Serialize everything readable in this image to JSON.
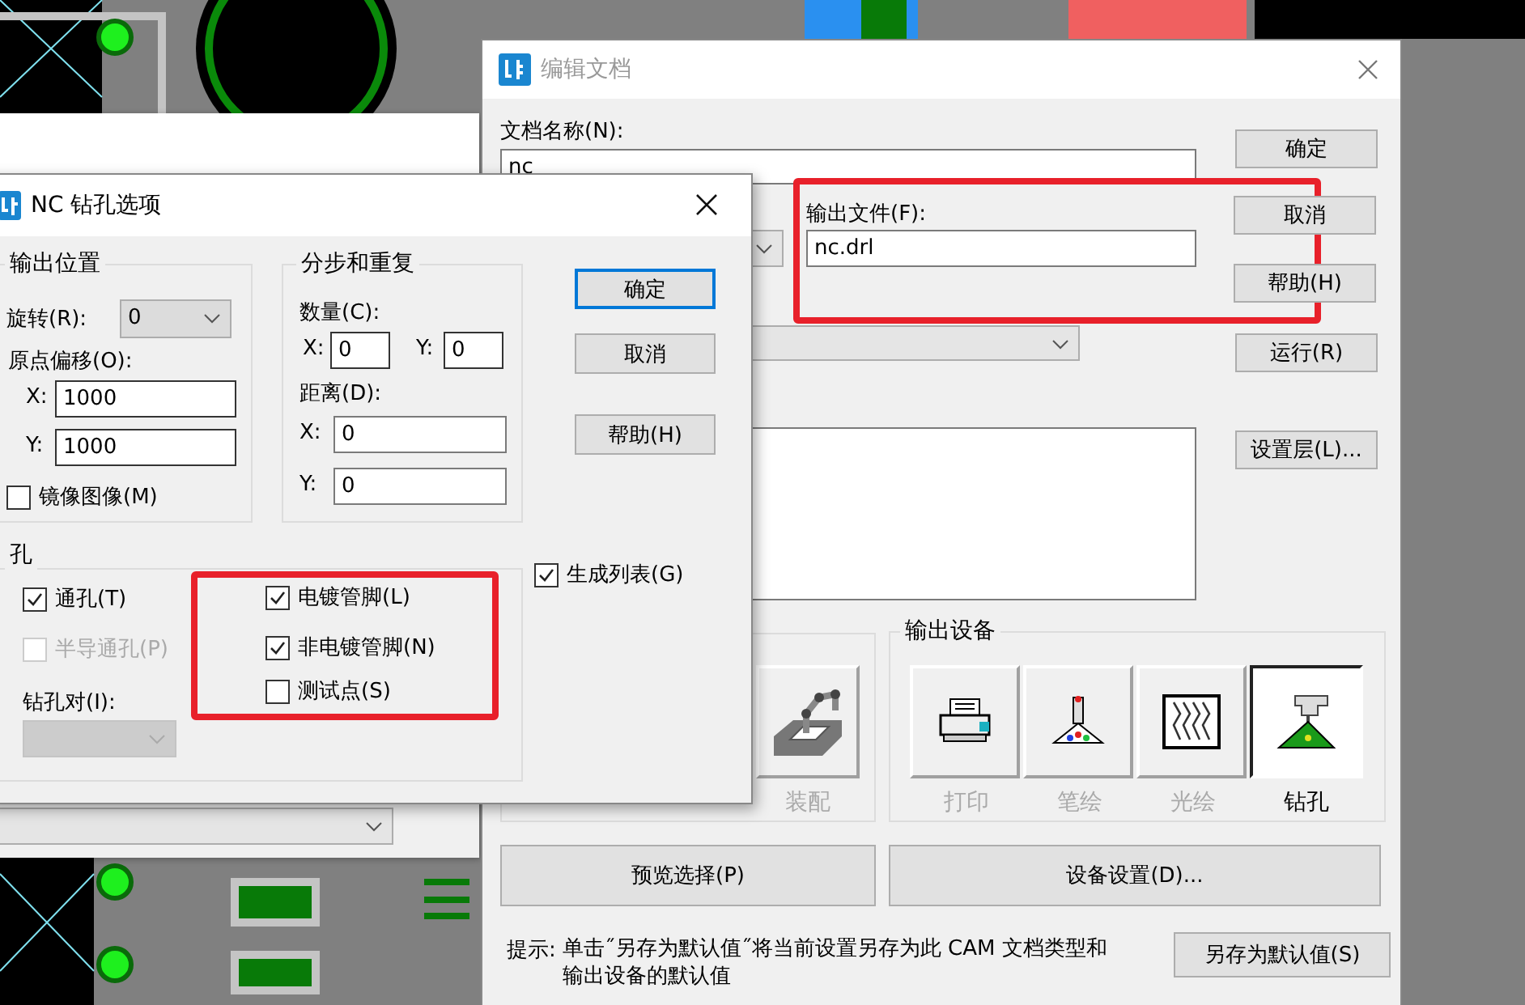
{
  "background": {
    "kind": "circuit_board"
  },
  "edit_dialog": {
    "title": "编辑文档",
    "doc_name": {
      "label": "文档名称(N):",
      "value": "nc"
    },
    "output_file": {
      "label": "输出文件(F):",
      "value": "nc.drl"
    },
    "side_buttons": [
      "确定",
      "取消",
      "帮助(H)",
      "运行(R)",
      "设置层(L)..."
    ],
    "assembly_label": "装配",
    "output_devices": {
      "title": "输出设备",
      "items": [
        {
          "kind": "printer",
          "label": "打印",
          "selected": false
        },
        {
          "kind": "pen",
          "label": "笔绘",
          "selected": false
        },
        {
          "kind": "photo",
          "label": "光绘",
          "selected": false
        },
        {
          "kind": "drill",
          "label": "钻孔",
          "selected": true
        }
      ]
    },
    "preview_button": "预览选择(P)",
    "device_settings_button": "设备设置(D)...",
    "hint": {
      "label": "提示:",
      "text": "单击˝另存为默认值˝将当前设置另存为此 CAM 文档类型和输出设备的默认值"
    },
    "save_default_button": "另存为默认值(S)"
  },
  "nc_dialog": {
    "title": "NC 钻孔选项",
    "output_position": {
      "title": "输出位置",
      "rotation_label": "旋转(R):",
      "rotation_value": "0",
      "origin_label": "原点偏移(O):",
      "x_label": "X:",
      "x_value": "1000",
      "y_label": "Y:",
      "y_value": "1000",
      "mirror": {
        "label": "镜像图像(M)",
        "checked": false
      }
    },
    "step_repeat": {
      "title": "分步和重复",
      "count_label": "数量(C):",
      "count_x_label": "X:",
      "count_x_value": "0",
      "count_y_label": "Y:",
      "count_y_value": "0",
      "distance_label": "距离(D):",
      "distance_x_label": "X:",
      "distance_x_value": "0",
      "distance_y_label": "Y:",
      "distance_y_value": "0"
    },
    "buttons": [
      "确定",
      "取消",
      "帮助(H)"
    ],
    "holes": {
      "title": "孔",
      "left_items": [
        {
          "label": "通孔(T)",
          "checked": true,
          "disabled": false
        },
        {
          "label": "半导通孔(P)",
          "checked": false,
          "disabled": true
        }
      ],
      "drill_pair_label": "钻孔对(I):",
      "right_items": [
        {
          "label": "电镀管脚(L)",
          "checked": true,
          "disabled": false
        },
        {
          "label": "非电镀管脚(N)",
          "checked": true,
          "disabled": false
        },
        {
          "label": "测试点(S)",
          "checked": false,
          "disabled": false
        }
      ]
    },
    "generate_list": {
      "label": "生成列表(G)",
      "checked": true
    }
  }
}
